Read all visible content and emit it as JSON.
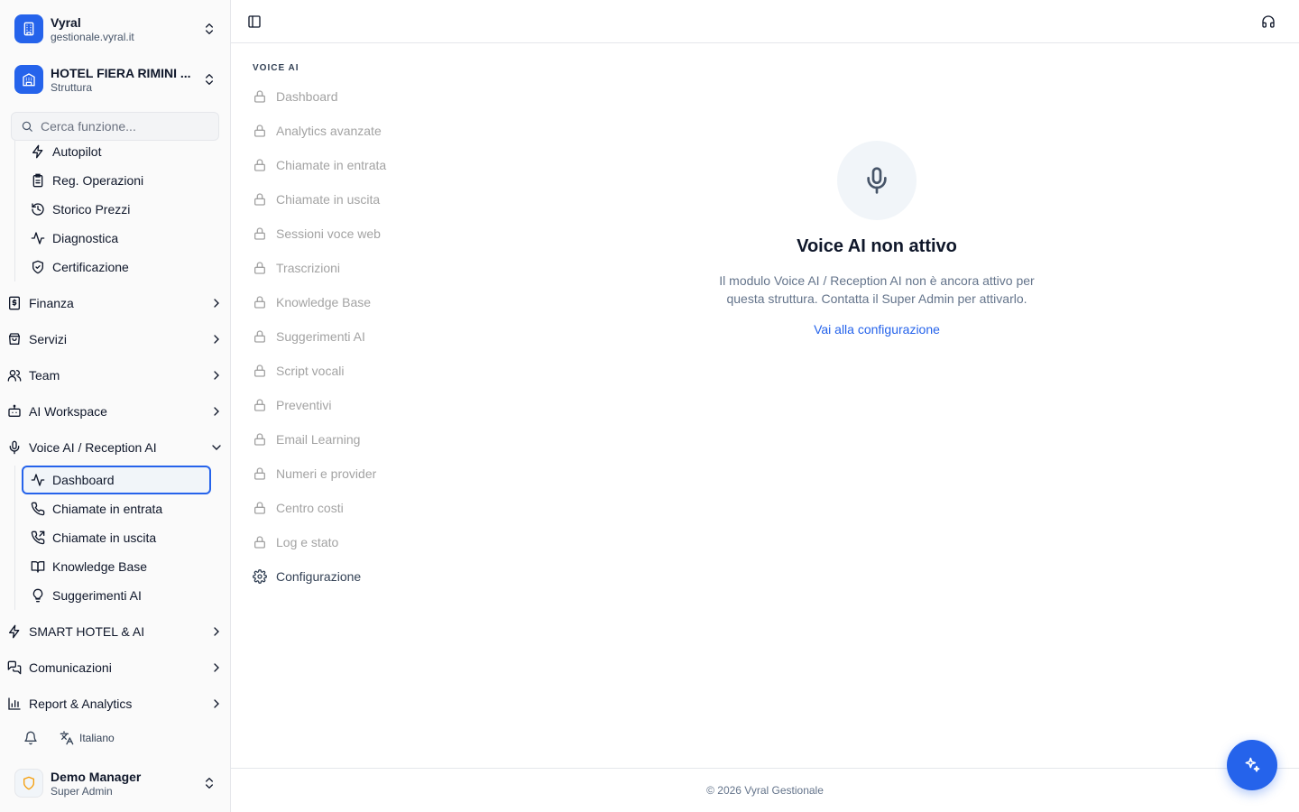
{
  "workspace": {
    "name": "Vyral",
    "domain": "gestionale.vyral.it"
  },
  "property": {
    "name": "HOTEL FIERA RIMINI ...",
    "type": "Struttura"
  },
  "search": {
    "placeholder": "Cerca funzione..."
  },
  "sidebar": {
    "upper_items": [
      {
        "label": "Autopilot",
        "icon": "zap-icon"
      },
      {
        "label": "Reg. Operazioni",
        "icon": "clipboard-icon"
      },
      {
        "label": "Storico Prezzi",
        "icon": "history-icon"
      },
      {
        "label": "Diagnostica",
        "icon": "activity-icon"
      },
      {
        "label": "Certificazione",
        "icon": "shield-check-icon"
      }
    ],
    "groups_top": [
      {
        "label": "Finanza",
        "icon": "receipt-icon"
      },
      {
        "label": "Servizi",
        "icon": "shopping-bag-icon"
      },
      {
        "label": "Team",
        "icon": "users-icon"
      },
      {
        "label": "AI Workspace",
        "icon": "bot-icon"
      }
    ],
    "voice_group": {
      "label": "Voice AI / Reception AI",
      "icon": "mic-icon",
      "items": [
        {
          "label": "Dashboard",
          "icon": "activity-icon",
          "active": true
        },
        {
          "label": "Chiamate in entrata",
          "icon": "phone-icon"
        },
        {
          "label": "Chiamate in uscita",
          "icon": "phone-outgoing-icon"
        },
        {
          "label": "Knowledge Base",
          "icon": "book-icon"
        },
        {
          "label": "Suggerimenti AI",
          "icon": "lightbulb-icon"
        }
      ]
    },
    "groups_bottom": [
      {
        "label": "SMART HOTEL & AI",
        "icon": "zap-icon"
      },
      {
        "label": "Comunicazioni",
        "icon": "messages-icon"
      },
      {
        "label": "Report & Analytics",
        "icon": "bar-chart-icon"
      }
    ]
  },
  "language": {
    "label": "Italiano"
  },
  "user": {
    "name": "Demo Manager",
    "role": "Super Admin"
  },
  "section_nav": {
    "title": "VOICE AI",
    "items": [
      {
        "label": "Dashboard",
        "locked": true
      },
      {
        "label": "Analytics avanzate",
        "locked": true
      },
      {
        "label": "Chiamate in entrata",
        "locked": true
      },
      {
        "label": "Chiamate in uscita",
        "locked": true
      },
      {
        "label": "Sessioni voce web",
        "locked": true
      },
      {
        "label": "Trascrizioni",
        "locked": true
      },
      {
        "label": "Knowledge Base",
        "locked": true
      },
      {
        "label": "Suggerimenti AI",
        "locked": true
      },
      {
        "label": "Script vocali",
        "locked": true
      },
      {
        "label": "Preventivi",
        "locked": true
      },
      {
        "label": "Email Learning",
        "locked": true
      },
      {
        "label": "Numeri e provider",
        "locked": true
      },
      {
        "label": "Centro costi",
        "locked": true
      },
      {
        "label": "Log e stato",
        "locked": true
      },
      {
        "label": "Configurazione",
        "locked": false
      }
    ]
  },
  "empty_state": {
    "title": "Voice AI non attivo",
    "description": "Il modulo Voice AI / Reception AI non è ancora attivo per questa struttura. Contatta il Super Admin per attivarlo.",
    "link": "Vai alla configurazione"
  },
  "footer": {
    "text": "© 2026 Vyral Gestionale"
  },
  "colors": {
    "accent": "#2563eb",
    "muted_text": "#a3a3a3",
    "border": "#e5e7eb"
  }
}
